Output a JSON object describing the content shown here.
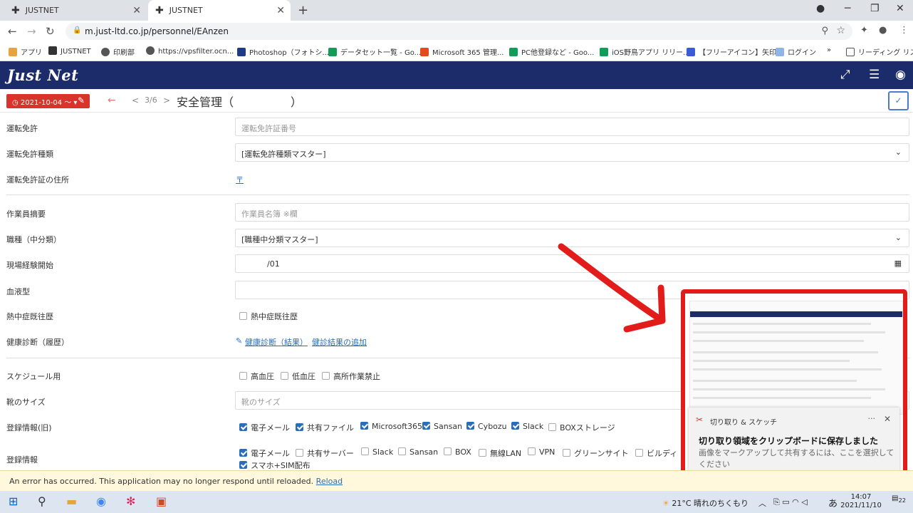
{
  "browser": {
    "tabs": [
      {
        "title": "JUSTNET"
      },
      {
        "title": "JUSTNET"
      }
    ],
    "url": "m.just-ltd.co.jp/personnel/EAnzen",
    "bookmarks": [
      "アプリ",
      "JUSTNET",
      "印刷部",
      "https://vpsfilter.ocn...",
      "Photoshop（フォトシ...",
      "データセット一覧 - Go...",
      "Microsoft 365 管理...",
      "PC他登録など - Goo...",
      "iOS野鳥アプリ リリー...",
      "【フリーアイコン】矢印...",
      "ログイン",
      "»",
      "リーディング リスト"
    ]
  },
  "app": {
    "logo": "Just Net",
    "date_filter": "2021-10-04 〜",
    "pager": {
      "prev": "<",
      "current": "3/6",
      "next": ">"
    },
    "page_title": "安全管理（　　　　　）",
    "confirm": "✓"
  },
  "form": {
    "license": {
      "label": "運転免許",
      "placeholder": "運転免許証番号"
    },
    "license_type": {
      "label": "運転免許種類",
      "value": "[運転免許種類マスター]"
    },
    "license_address": {
      "label": "運転免許証の住所",
      "value": "〒"
    },
    "worker_summary": {
      "label": "作業員摘要",
      "placeholder": "作業員名簿 ※欄"
    },
    "job_type": {
      "label": "職種（中分類）",
      "value": "[職種中分類マスター]"
    },
    "experience_start": {
      "label": "現場経験開始",
      "value": "/01"
    },
    "blood_type": {
      "label": "血液型",
      "value": ""
    },
    "heatstroke": {
      "label": "熱中症既往歴",
      "option": "熱中症既往歴"
    },
    "health_check": {
      "label": "健康診断（履歴）",
      "link1": "健康診断（結果）",
      "link2": "健診結果の追加"
    },
    "schedule": {
      "label": "スケジュール用",
      "options": [
        "高血圧",
        "低血圧",
        "高所作業禁止"
      ]
    },
    "shoe_size": {
      "label": "靴のサイズ",
      "placeholder": "靴のサイズ"
    },
    "registration_old": {
      "label": "登録情報(旧)",
      "options": [
        {
          "text": "電子メール",
          "checked": true
        },
        {
          "text": "共有ファイル",
          "checked": true
        },
        {
          "text": "Microsoft365",
          "checked": true
        },
        {
          "text": "Sansan",
          "checked": true
        },
        {
          "text": "Cybozu",
          "checked": true
        },
        {
          "text": "Slack",
          "checked": true
        },
        {
          "text": "BOXストレージ",
          "checked": false
        }
      ]
    },
    "registration": {
      "label": "登録情報",
      "options": [
        {
          "text": "電子メール",
          "checked": true
        },
        {
          "text": "共有サーバー",
          "checked": false
        },
        {
          "text": "Slack",
          "checked": false
        },
        {
          "text": "Sansan",
          "checked": false
        },
        {
          "text": "BOX",
          "checked": false
        },
        {
          "text": "無線LAN",
          "checked": false
        },
        {
          "text": "VPN",
          "checked": false
        },
        {
          "text": "グリーンサイト",
          "checked": false
        },
        {
          "text": "ビルディ",
          "checked": false
        },
        {
          "text": "スマホ+SIM配布",
          "checked": true
        }
      ]
    }
  },
  "error_bar": {
    "message": "An error has occurred. This application may no longer respond until reloaded.",
    "reload": "Reload"
  },
  "snip_toast": {
    "app": "切り取り & スケッチ",
    "title": "切り取り領域をクリップボードに保存しました",
    "body": "画像をマークアップして共有するには、ここを選択してください"
  },
  "taskbar": {
    "weather": "21°C  晴れのちくもり",
    "ime": "あ",
    "time": "14:07",
    "date": "2021/11/10",
    "notifications": "22"
  },
  "colors": {
    "header": "#1c2c6b",
    "accent_red": "#d9342b",
    "link": "#2a6ebb",
    "annotation": "#e21b1b"
  }
}
